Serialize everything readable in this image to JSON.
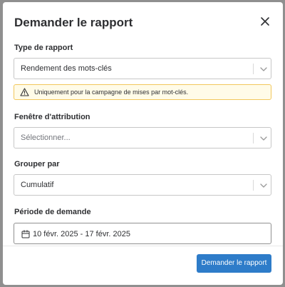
{
  "dialog": {
    "title": "Demander le rapport",
    "close_icon": "close-icon"
  },
  "report_type": {
    "label": "Type de rapport",
    "value": "Rendement des mots-clés"
  },
  "alert": {
    "icon": "warning-icon",
    "text": "Uniquement pour la campagne de mises par mot-clés."
  },
  "attribution_window": {
    "label": "Fenêtre d'attribution",
    "placeholder": "Sélectionner..."
  },
  "group_by": {
    "label": "Grouper par",
    "value": "Cumulatif"
  },
  "request_period": {
    "label": "Période de demande",
    "icon": "calendar-icon",
    "value": "10 févr. 2025 - 17 févr. 2025"
  },
  "footer": {
    "submit_label": "Demander le rapport"
  },
  "colors": {
    "primary": "#2e7cc9",
    "alert_bg": "#fffbe8",
    "alert_border": "#f2c75c",
    "overlay": "#8f8f8f"
  }
}
